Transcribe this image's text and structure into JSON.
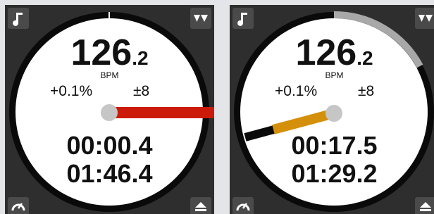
{
  "decks": [
    {
      "bpm_integer": "126",
      "bpm_decimal": ".2",
      "bpm_label": "BPM",
      "pitch": "+0.1%",
      "pitch_range": "±8",
      "elapsed_time": "00:00.4",
      "remaining_time": "01:46.4",
      "progress": 0.004,
      "marker_color": "#cc1a0a"
    },
    {
      "bpm_integer": "126",
      "bpm_decimal": ".2",
      "bpm_label": "BPM",
      "pitch": "+0.1%",
      "pitch_range": "±8",
      "elapsed_time": "00:17.5",
      "remaining_time": "01:29.2",
      "progress": 0.164,
      "marker_color": "#d4900a"
    }
  ],
  "icons": {
    "top_left": "music-note-icon",
    "top_right": "double-triangle-down-icon",
    "bottom_left": "sync-gauge-icon",
    "bottom_right": "eject-icon"
  }
}
